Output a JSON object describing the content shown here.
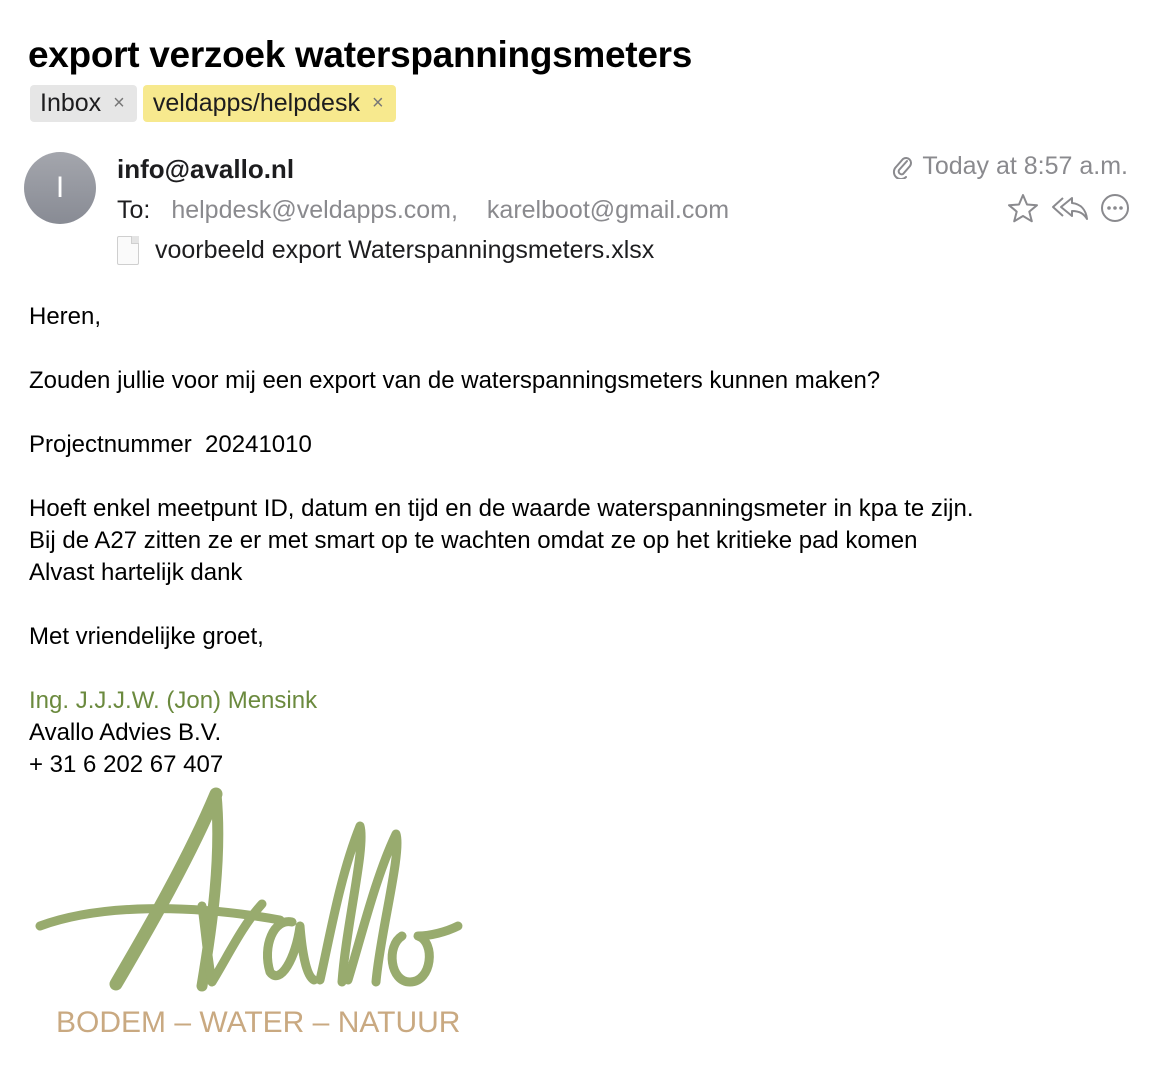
{
  "email": {
    "subject": "export verzoek waterspanningsmeters",
    "tags": [
      {
        "label": "Inbox",
        "remove": "×"
      },
      {
        "label": "veldapps/helpdesk",
        "remove": "×"
      }
    ],
    "avatar_initial": "I",
    "sender": "info@avallo.nl",
    "to_label": "To:",
    "recipients": [
      "helpdesk@veldapps.com,",
      "karelboot@gmail.com"
    ],
    "attachment": "voorbeeld export Waterspanningsmeters.xlsx",
    "date": "Today at 8:57 a.m."
  },
  "body": {
    "lines": [
      "Heren,",
      "",
      "Zouden jullie voor mij een export van de waterspanningsmeters kunnen maken?",
      "",
      "Projectnummer  20241010",
      "",
      "Hoeft enkel meetpunt ID, datum en tijd en de waarde waterspanningsmeter in kpa te zijn.",
      "Bij de A27 zitten ze er met smart op te wachten omdat ze op het kritieke pad komen",
      "Alvast hartelijk dank",
      "",
      "Met vriendelijke groet,",
      ""
    ],
    "signature": {
      "name": "Ing. J.J.J.W. (Jon) Mensink",
      "company": "Avallo Advies B.V.",
      "phone": "+ 31 6 202 67 407"
    }
  },
  "logo": {
    "wordmark": "Avallo",
    "tagline": "BODEM – WATER – NATUUR"
  },
  "colors": {
    "signature_green": "#6b8a3e",
    "logo_green": "#98ab6e",
    "logo_tan": "#c9a981",
    "folder_tag": "#f7e98e",
    "inbox_tag": "#e6e6e6",
    "muted": "#8a8a8e"
  },
  "icons": [
    "paperclip-icon",
    "star-icon",
    "reply-all-icon",
    "more-icon",
    "file-icon"
  ]
}
